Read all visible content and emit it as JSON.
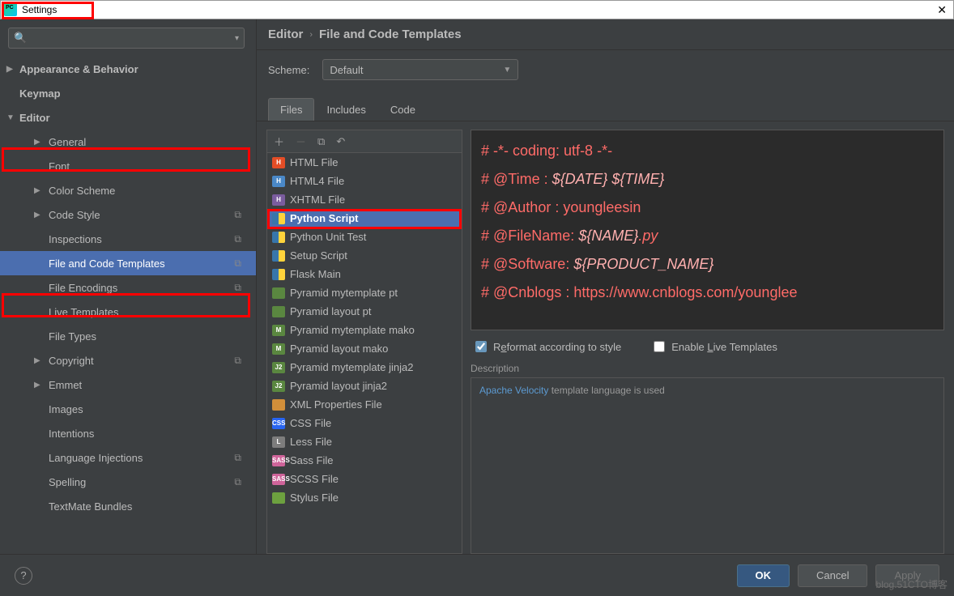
{
  "window": {
    "title": "Settings"
  },
  "breadcrumb": {
    "part1": "Editor",
    "part2": "File and Code Templates"
  },
  "scheme": {
    "label": "Scheme:",
    "value": "Default"
  },
  "tabs": [
    "Files",
    "Includes",
    "Code"
  ],
  "sidebar": {
    "items": [
      {
        "label": "Appearance & Behavior",
        "lvl": "top",
        "arrow": "▶"
      },
      {
        "label": "Keymap",
        "lvl": "top",
        "arrow": ""
      },
      {
        "label": "Editor",
        "lvl": "top",
        "arrow": "▼"
      },
      {
        "label": "General",
        "lvl": "sub",
        "arrow": "▶"
      },
      {
        "label": "Font",
        "lvl": "sub",
        "arrow": ""
      },
      {
        "label": "Color Scheme",
        "lvl": "sub",
        "arrow": "▶"
      },
      {
        "label": "Code Style",
        "lvl": "sub",
        "arrow": "▶",
        "badge": "⧉"
      },
      {
        "label": "Inspections",
        "lvl": "sub",
        "arrow": "",
        "badge": "⧉"
      },
      {
        "label": "File and Code Templates",
        "lvl": "sub",
        "arrow": "",
        "badge": "⧉",
        "selected": true
      },
      {
        "label": "File Encodings",
        "lvl": "sub",
        "arrow": "",
        "badge": "⧉"
      },
      {
        "label": "Live Templates",
        "lvl": "sub",
        "arrow": ""
      },
      {
        "label": "File Types",
        "lvl": "sub",
        "arrow": ""
      },
      {
        "label": "Copyright",
        "lvl": "sub",
        "arrow": "▶",
        "badge": "⧉"
      },
      {
        "label": "Emmet",
        "lvl": "sub",
        "arrow": "▶"
      },
      {
        "label": "Images",
        "lvl": "sub",
        "arrow": ""
      },
      {
        "label": "Intentions",
        "lvl": "sub",
        "arrow": ""
      },
      {
        "label": "Language Injections",
        "lvl": "sub",
        "arrow": "",
        "badge": "⧉"
      },
      {
        "label": "Spelling",
        "lvl": "sub",
        "arrow": "",
        "badge": "⧉"
      },
      {
        "label": "TextMate Bundles",
        "lvl": "sub",
        "arrow": ""
      }
    ]
  },
  "files": [
    {
      "label": "HTML File",
      "icon": "ic-html",
      "t": "H"
    },
    {
      "label": "HTML4 File",
      "icon": "ic-html4",
      "t": "H"
    },
    {
      "label": "XHTML File",
      "icon": "ic-xhtml",
      "t": "H"
    },
    {
      "label": "Python Script",
      "icon": "ic-py",
      "t": "",
      "selected": true
    },
    {
      "label": "Python Unit Test",
      "icon": "ic-py",
      "t": ""
    },
    {
      "label": "Setup Script",
      "icon": "ic-py",
      "t": ""
    },
    {
      "label": "Flask Main",
      "icon": "ic-py",
      "t": ""
    },
    {
      "label": "Pyramid mytemplate pt",
      "icon": "ic-j2",
      "t": ""
    },
    {
      "label": "Pyramid layout pt",
      "icon": "ic-j2",
      "t": ""
    },
    {
      "label": "Pyramid mytemplate mako",
      "icon": "ic-mako",
      "t": "M"
    },
    {
      "label": "Pyramid layout mako",
      "icon": "ic-mako",
      "t": "M"
    },
    {
      "label": "Pyramid mytemplate jinja2",
      "icon": "ic-j2",
      "t": "J2"
    },
    {
      "label": "Pyramid layout jinja2",
      "icon": "ic-j2",
      "t": "J2"
    },
    {
      "label": "XML Properties File",
      "icon": "ic-xml",
      "t": ""
    },
    {
      "label": "CSS File",
      "icon": "ic-css",
      "t": "CSS"
    },
    {
      "label": "Less File",
      "icon": "ic-less",
      "t": "L"
    },
    {
      "label": "Sass File",
      "icon": "ic-sass",
      "t": "SASS"
    },
    {
      "label": "SCSS File",
      "icon": "ic-scss",
      "t": "SASS"
    },
    {
      "label": "Stylus File",
      "icon": "ic-stylus",
      "t": ""
    }
  ],
  "code": {
    "l1a": "# -*- coding: utf-8 -*-",
    "l2a": "# @Time    :",
    "l2b": " ${DATE} ${TIME}",
    "l3a": "# @Author  : youngleesin",
    "l4a": "# @FileName:",
    "l4b": " ${NAME}",
    "l4c": ".py",
    "l5a": "# @Software:",
    "l5b": " ${PRODUCT_NAME}",
    "l6a": "# @Cnblogs : https://www.cnblogs.com/younglee"
  },
  "reformat": {
    "label_pre": "R",
    "label_u": "e",
    "label_post": "format according to style"
  },
  "enablelive": {
    "label_pre": "Enable ",
    "label_u": "L",
    "label_post": "ive Templates"
  },
  "desc": {
    "label": "Description",
    "link": "Apache Velocity",
    "text": " template language is used"
  },
  "buttons": {
    "ok": "OK",
    "cancel": "Cancel",
    "apply": "Apply"
  },
  "watermark": "blog.51CTO博客"
}
